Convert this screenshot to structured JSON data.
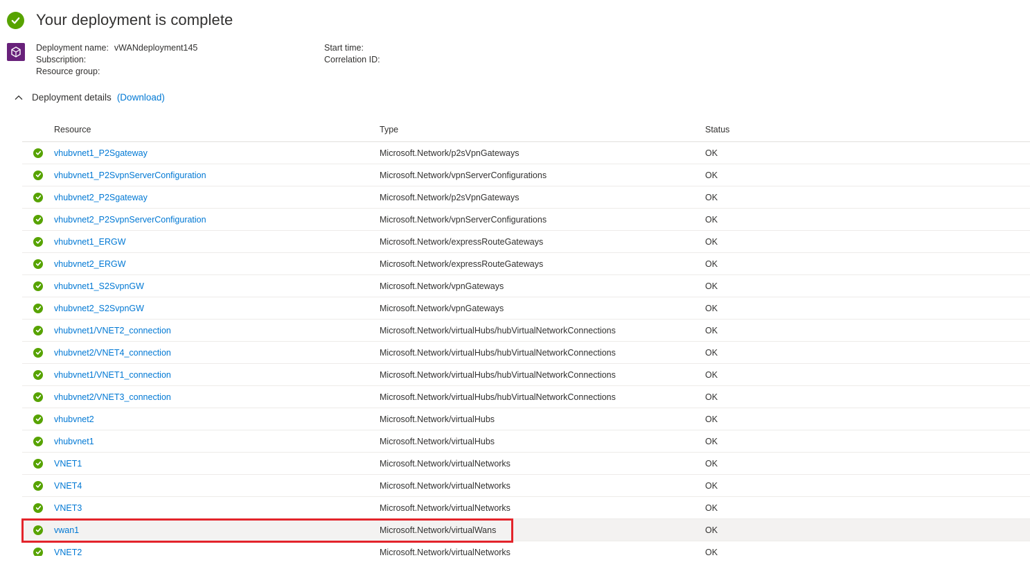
{
  "header": {
    "title": "Your deployment is complete"
  },
  "meta": {
    "deployment_name_label": "Deployment name:",
    "deployment_name_value": "vWANdeployment145",
    "subscription_label": "Subscription:",
    "resource_group_label": "Resource group:",
    "start_time_label": "Start time:",
    "correlation_id_label": "Correlation ID:"
  },
  "details": {
    "title": "Deployment details",
    "download_label": "(Download)"
  },
  "table": {
    "columns": [
      "Resource",
      "Type",
      "Status"
    ],
    "rows": [
      {
        "resource": "vhubvnet1_P2Sgateway",
        "type": "Microsoft.Network/p2sVpnGateways",
        "status": "OK"
      },
      {
        "resource": "vhubvnet1_P2SvpnServerConfiguration",
        "type": "Microsoft.Network/vpnServerConfigurations",
        "status": "OK"
      },
      {
        "resource": "vhubvnet2_P2Sgateway",
        "type": "Microsoft.Network/p2sVpnGateways",
        "status": "OK"
      },
      {
        "resource": "vhubvnet2_P2SvpnServerConfiguration",
        "type": "Microsoft.Network/vpnServerConfigurations",
        "status": "OK"
      },
      {
        "resource": "vhubvnet1_ERGW",
        "type": "Microsoft.Network/expressRouteGateways",
        "status": "OK"
      },
      {
        "resource": "vhubvnet2_ERGW",
        "type": "Microsoft.Network/expressRouteGateways",
        "status": "OK"
      },
      {
        "resource": "vhubvnet1_S2SvpnGW",
        "type": "Microsoft.Network/vpnGateways",
        "status": "OK"
      },
      {
        "resource": "vhubvnet2_S2SvpnGW",
        "type": "Microsoft.Network/vpnGateways",
        "status": "OK"
      },
      {
        "resource": "vhubvnet1/VNET2_connection",
        "type": "Microsoft.Network/virtualHubs/hubVirtualNetworkConnections",
        "status": "OK"
      },
      {
        "resource": "vhubvnet2/VNET4_connection",
        "type": "Microsoft.Network/virtualHubs/hubVirtualNetworkConnections",
        "status": "OK"
      },
      {
        "resource": "vhubvnet1/VNET1_connection",
        "type": "Microsoft.Network/virtualHubs/hubVirtualNetworkConnections",
        "status": "OK"
      },
      {
        "resource": "vhubvnet2/VNET3_connection",
        "type": "Microsoft.Network/virtualHubs/hubVirtualNetworkConnections",
        "status": "OK"
      },
      {
        "resource": "vhubvnet2",
        "type": "Microsoft.Network/virtualHubs",
        "status": "OK"
      },
      {
        "resource": "vhubvnet1",
        "type": "Microsoft.Network/virtualHubs",
        "status": "OK"
      },
      {
        "resource": "VNET1",
        "type": "Microsoft.Network/virtualNetworks",
        "status": "OK"
      },
      {
        "resource": "VNET4",
        "type": "Microsoft.Network/virtualNetworks",
        "status": "OK"
      },
      {
        "resource": "VNET3",
        "type": "Microsoft.Network/virtualNetworks",
        "status": "OK"
      },
      {
        "resource": "vwan1",
        "type": "Microsoft.Network/virtualWans",
        "status": "OK",
        "selected": true
      },
      {
        "resource": "VNET2",
        "type": "Microsoft.Network/virtualNetworks",
        "status": "OK"
      }
    ]
  },
  "colors": {
    "success": "#57a300",
    "link": "#0078d4",
    "highlight": "#e3242b",
    "deploy_icon": "#68217a"
  }
}
